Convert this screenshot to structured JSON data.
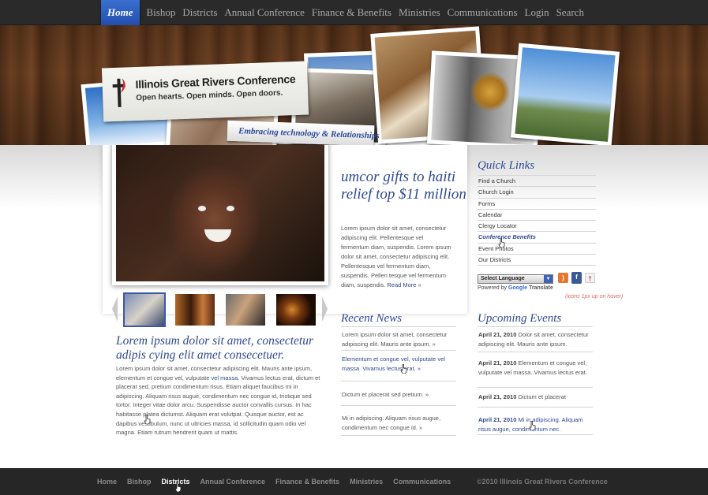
{
  "nav": {
    "items": [
      "Home",
      "Bishop",
      "Districts",
      "Annual Conference",
      "Finance & Benefits",
      "Ministries",
      "Communications",
      "Login",
      "Search"
    ],
    "active": "Home"
  },
  "header": {
    "logo_title": "Illinois Great Rivers Conference",
    "logo_tagline": "Open hearts. Open minds. Open doors.",
    "ribbon": "Embracing technology & Relationships"
  },
  "feature": {
    "title": "umcor gifts to haiti relief top $11 million",
    "text": "Lorem ipsum dolor sit amet, consectetur adipiscing elit. Pellentesque vel fermentum diam, suspendis. Lorem ipsum dolor sit amet, consectetur adipiscing elit. Pellentesque vel fermentum diam, suspendis. Pellen tesque vel fermentum diam, suspendis.",
    "read_more": "Read More »"
  },
  "article": {
    "title": "Lorem ipsum dolor sit amet, consectetur adipis cying elit amet consecetuer.",
    "text_before_link": "Lorem ipsum dolor sit amet, consectetur adipiscing elit. Mauris ante ipsum, elementum et congue vel, vulputate",
    "link": "vel massa",
    "text_after_link": ". Vivamus lectus erat, dictum et placerat sed, pretium condimentum risus. Etiam aliquet faucibus mi in adipiscing. Aliquam risus augue, condimentum nec congue id, tristique sed tortor. Integer vitae dolor arcu. Suspendisse auctor convallis cursus. In hac habitasse platea dictumst. Aliquam erat volutpat. Quisque auctor, est ac dapibus vestibulum, nunc ut ultricies massa, id sollicitudin quam odio vel magna. Etiam rutrum hendrerit quam ut mattis."
  },
  "recent_news": {
    "title": "Recent News",
    "items": [
      "Lorem ipsum dolor sit amet, consectetur adipiscing elit. Mauris ante ipsum. »",
      "Elementum et congue vel, vulputate vel massa. Vivamus lectus erat. »",
      "Dictum et placerat sed pretium. »",
      "Mi in adipiscing. Aliquam risus augue, condimentum nec congue id. »"
    ]
  },
  "quick_links": {
    "title": "Quick Links",
    "items": [
      "Find a Church",
      "Church Login",
      "Forms",
      "Calendar",
      "Clergy Locator",
      "Conference Benefits",
      "Event Photos",
      "Our Districts"
    ],
    "hovered": "Conference Benefits"
  },
  "translate": {
    "select_label": "Select Language",
    "powered_by": "Powered by",
    "google": "Google",
    "translate": "Translate",
    "icons_note": "(icons 1px up on hover)"
  },
  "events": {
    "title": "Upcoming Events",
    "items": [
      {
        "date": "April 21, 2010",
        "text": "Dolor sit amet, consectetur adipiscing elit. Mauris ante ipsum."
      },
      {
        "date": "April 21, 2010",
        "text": "Elementum et congue vel, vulputate vel massa. Vivamus lectus erat."
      },
      {
        "date": "April 21, 2010",
        "text": "Dictum et placerat"
      },
      {
        "date": "April 21, 2010",
        "text": "Mi in adipiscing. Aliquam risus augue, condimentum nec."
      }
    ]
  },
  "footer": {
    "items": [
      "Home",
      "Bishop",
      "Districts",
      "Annual Conference",
      "Finance & Benefits",
      "Ministries",
      "Communications"
    ],
    "active": "Districts",
    "copyright": "©2010 Illinois Great Rivers Conference"
  },
  "colors": {
    "accent_blue": "#2f4a93",
    "nav_active": "#1d49a8",
    "note_red": "#e06a5c",
    "rss_orange": "#e8772e",
    "facebook_blue": "#3b5998"
  }
}
